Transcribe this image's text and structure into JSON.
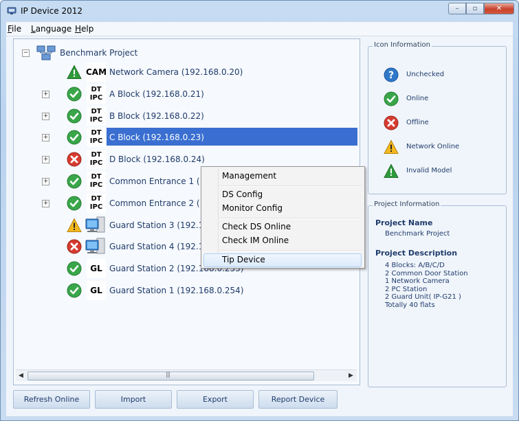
{
  "window": {
    "title": "IP Device 2012",
    "minimize_glyph": "–",
    "restore_glyph": "▫",
    "close_glyph": "✕"
  },
  "menu": [
    {
      "underline": "F",
      "rest": "ile"
    },
    {
      "underline": "L",
      "rest": "anguage"
    },
    {
      "underline": "H",
      "rest": "elp"
    }
  ],
  "tree": {
    "root": {
      "label": "Benchmark Project",
      "expander": "−",
      "icon": "network-project-icon"
    },
    "items": [
      {
        "status": "invalid-model",
        "type_lines": [
          "CAM"
        ],
        "label": "Network Camera (192.168.0.20)",
        "expander": ""
      },
      {
        "status": "online",
        "type_lines": [
          "DT",
          "IPC"
        ],
        "label": "A Block (192.168.0.21)",
        "expander": "+"
      },
      {
        "status": "online",
        "type_lines": [
          "DT",
          "IPC"
        ],
        "label": "B Block (192.168.0.22)",
        "expander": "+"
      },
      {
        "status": "online",
        "type_lines": [
          "DT",
          "IPC"
        ],
        "label": "C Block (192.168.0.23)",
        "expander": "+",
        "selected": true
      },
      {
        "status": "offline",
        "type_lines": [
          "DT",
          "IPC"
        ],
        "label": "D Block (192.168.0.24)",
        "expander": "+"
      },
      {
        "status": "online",
        "type_lines": [
          "DT",
          "IPC"
        ],
        "label": "Common Entrance 1 (192",
        "expander": "+"
      },
      {
        "status": "online",
        "type_lines": [
          "DT",
          "IPC"
        ],
        "label": "Common Entrance 2 (192",
        "expander": "+"
      },
      {
        "status": "network-online",
        "type_lines": [],
        "type_icon": "pc",
        "label": "Guard Station 3 (192.168.",
        "expander": ""
      },
      {
        "status": "offline",
        "type_lines": [],
        "type_icon": "pc",
        "label": "Guard Station 4 (192.168.0.244)",
        "expander": ""
      },
      {
        "status": "online",
        "type_lines": [
          "GL"
        ],
        "label": "Guard Station 2 (192.168.0.253)",
        "expander": ""
      },
      {
        "status": "online",
        "type_lines": [
          "GL"
        ],
        "label": "Guard Station 1 (192.168.0.254)",
        "expander": ""
      }
    ],
    "scroll_left": "◀",
    "scroll_right": "▶",
    "scroll_grip": "|||"
  },
  "context_menu": {
    "items": [
      "Management",
      "DS Config",
      "Monitor Config",
      "Check DS Online",
      "Check IM Online",
      "Tip Device"
    ],
    "highlighted": "Tip Device"
  },
  "icon_information": {
    "title": "Icon Information",
    "items": [
      {
        "icon": "unchecked",
        "label": "Unchecked"
      },
      {
        "icon": "online",
        "label": "Online"
      },
      {
        "icon": "offline",
        "label": "Offline"
      },
      {
        "icon": "network-online",
        "label": "Network Online"
      },
      {
        "icon": "invalid-model",
        "label": "Invalid Model"
      }
    ]
  },
  "project_information": {
    "title": "Project Information",
    "name_heading": "Project Name",
    "name": "Benchmark Project",
    "description_heading": "Project Description",
    "description_lines": [
      "4 Blocks: A/B/C/D",
      "2 Common Door Station",
      "1 Network Camera",
      "2 PC Station",
      "2 Guard Unit( IP-G21 )",
      "Totally 40 flats"
    ]
  },
  "buttons": {
    "refresh": "Refresh Online",
    "import": "Import",
    "export": "Export",
    "report": "Report Device"
  },
  "colors": {
    "online": "#3aa64a",
    "offline": "#d63b2f",
    "unchecked": "#2f78c9",
    "warning": "#f3b81f",
    "invalid": "#2f9b3c",
    "selection": "#3a6fd1"
  }
}
